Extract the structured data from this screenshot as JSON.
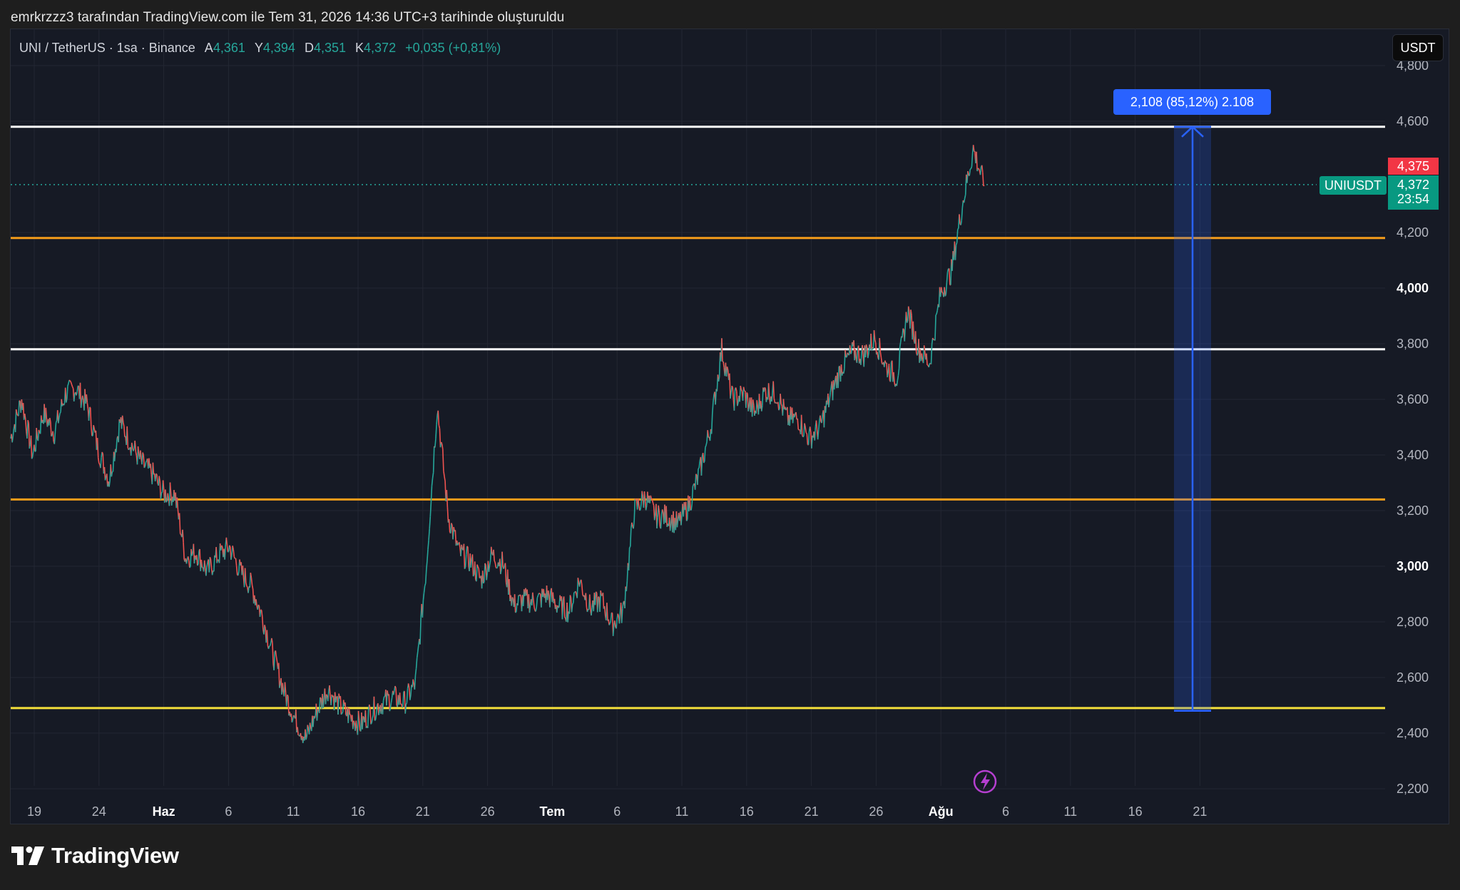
{
  "header": {
    "attribution": "emrkrzzz3 tarafından TradingView.com ile Tem 31, 2026 14:36 UTC+3 tarihinde oluşturuldu"
  },
  "symbol": {
    "name": "UNI / TetherUS · 1sa · Binance",
    "open_label": "A",
    "open": "4,361",
    "high_label": "Y",
    "high": "4,394",
    "low_label": "D",
    "low": "4,351",
    "close_label": "K",
    "close": "4,372",
    "change": "+0,035 (+0,81%)"
  },
  "currency_button": "USDT",
  "price_tags": {
    "red_value": "4,375",
    "ticker": "UNIUSDT",
    "current": "4,372",
    "countdown": "23:54"
  },
  "measure": {
    "label": "2,108 (85,12%) 2.108"
  },
  "brand": {
    "name": "TradingView"
  },
  "colors": {
    "up": "#26a69a",
    "down": "#ef5350",
    "background": "#161a25",
    "orange_line": "#f59c1a",
    "yellow_line": "#f5e03a",
    "white_line": "#ffffff",
    "measure": "#2962ff"
  },
  "icons": {
    "lightning": "lightning-icon",
    "logo": "tradingview-logo-icon"
  },
  "chart_data": {
    "type": "line",
    "title": "UNI / TetherUS · 1sa · Binance",
    "y_axis": {
      "ticks": [
        "4,800",
        "4,600",
        "4,200",
        "4,000",
        "3,800",
        "3,600",
        "3,400",
        "3,200",
        "3,000",
        "2,800",
        "2,600",
        "2,400",
        "2,200"
      ],
      "bold_ticks": [
        "4,000",
        "3,000"
      ],
      "range": [
        2.14,
        4.87
      ]
    },
    "x_axis": {
      "ticks": [
        "19",
        "24",
        "Haz",
        "6",
        "11",
        "16",
        "21",
        "26",
        "Tem",
        "6",
        "11",
        "16",
        "21",
        "26",
        "Ağu",
        "6",
        "11",
        "16",
        "21"
      ],
      "bold_ticks": [
        "Haz",
        "Tem",
        "Ağu"
      ]
    },
    "horizontal_lines": [
      {
        "price": 4.58,
        "color": "white"
      },
      {
        "price": 4.18,
        "color": "orange"
      },
      {
        "price": 3.78,
        "color": "white"
      },
      {
        "price": 3.24,
        "color": "orange"
      },
      {
        "price": 2.49,
        "color": "yellow"
      }
    ],
    "measure_range": {
      "from": 2.48,
      "to": 4.58,
      "change": "2,108 (85,12%) 2.108"
    },
    "series": [
      {
        "values": [
          3.46,
          3.6,
          3.4,
          3.55,
          3.48,
          3.62,
          3.64,
          3.58,
          3.42,
          3.31,
          3.52,
          3.44,
          3.37,
          3.33,
          3.26,
          3.26,
          3.03,
          3.05,
          2.98,
          3.04,
          3.07,
          2.98,
          2.93,
          2.82,
          2.68,
          2.55,
          2.45,
          2.38,
          2.48,
          2.56,
          2.5,
          2.46,
          2.43,
          2.48,
          2.51,
          2.53,
          2.51,
          2.58,
          3.0,
          3.58,
          3.18,
          3.05,
          3.02,
          2.95,
          3.04,
          3.01,
          2.86,
          2.88,
          2.87,
          2.9,
          2.86,
          2.84,
          2.95,
          2.85,
          2.88,
          2.79,
          2.84,
          3.2,
          3.25,
          3.18,
          3.18,
          3.15,
          3.22,
          3.34,
          3.5,
          3.78,
          3.6,
          3.62,
          3.55,
          3.63,
          3.62,
          3.53,
          3.53,
          3.46,
          3.5,
          3.62,
          3.72,
          3.77,
          3.76,
          3.82,
          3.72,
          3.68,
          3.92,
          3.78,
          3.73,
          3.98,
          4.06,
          4.3,
          4.5,
          4.37
        ]
      }
    ]
  }
}
